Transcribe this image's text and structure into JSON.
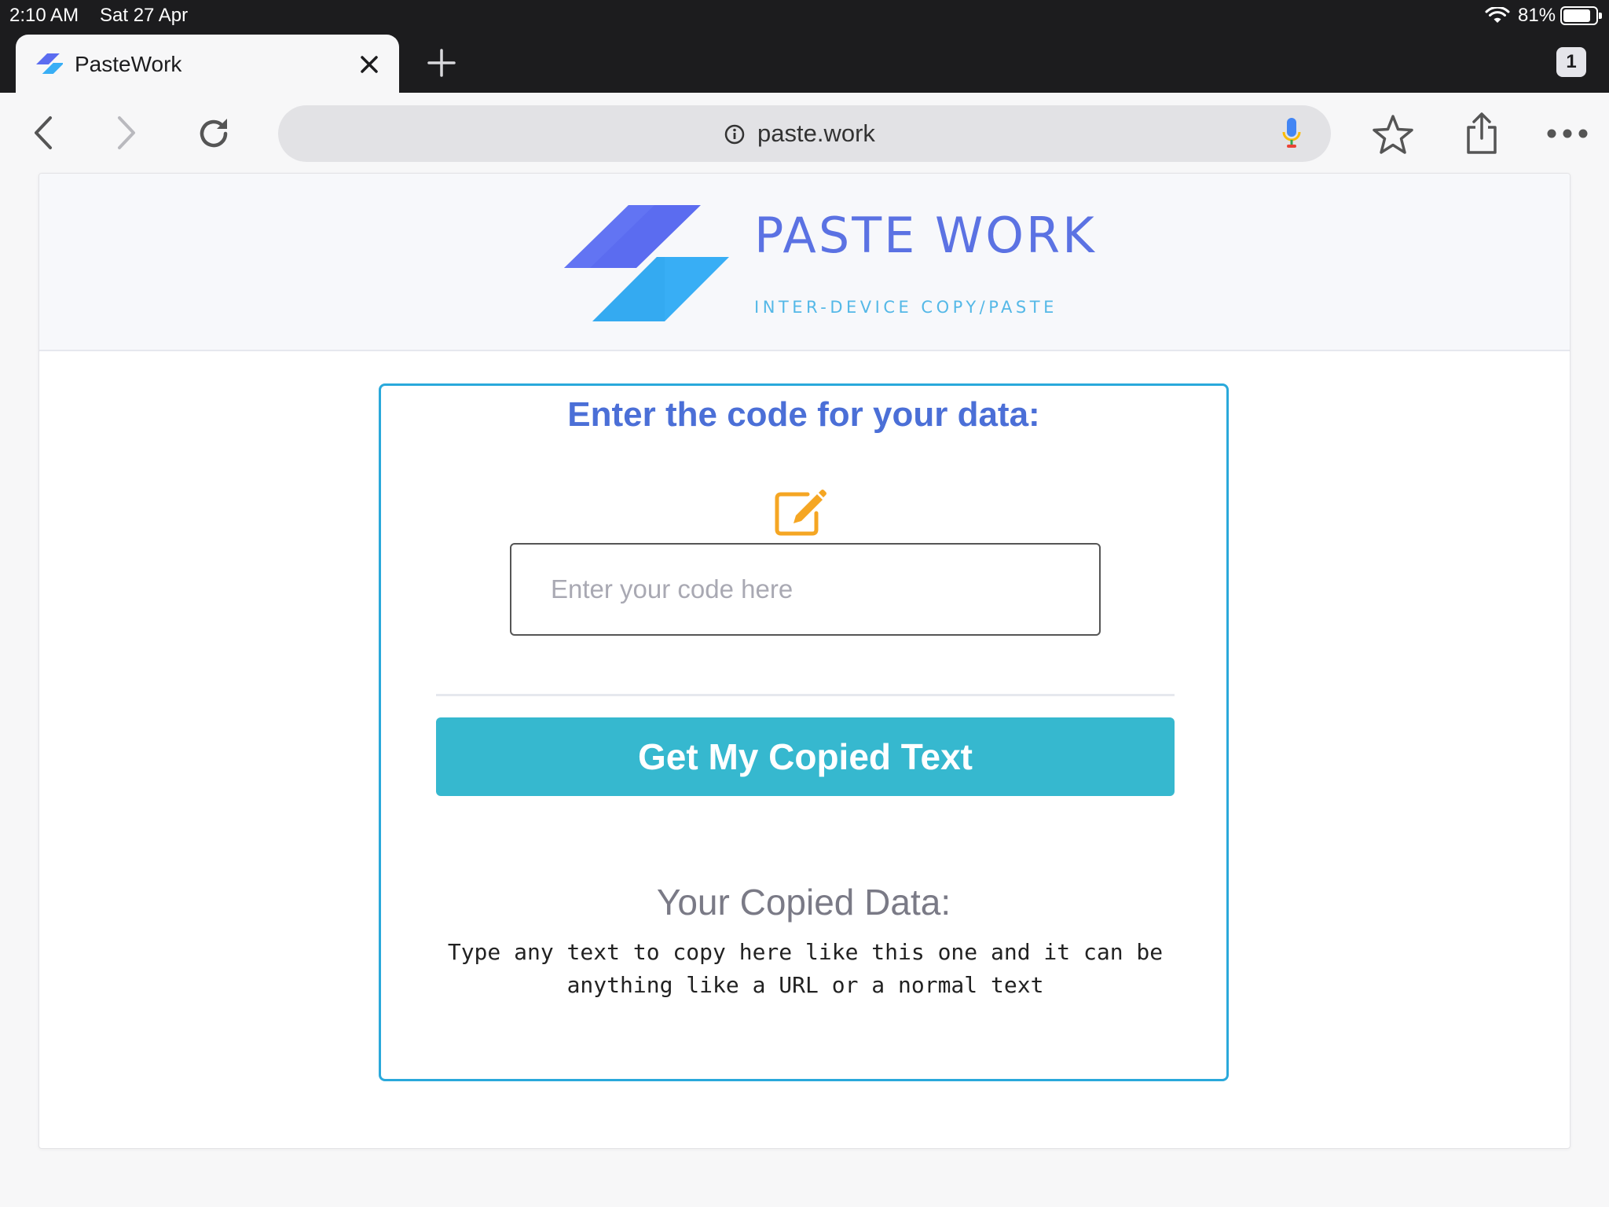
{
  "status_bar": {
    "time": "2:10 AM",
    "date": "Sat 27 Apr",
    "battery": "81%"
  },
  "tabs": [
    {
      "title": "PasteWork"
    }
  ],
  "tab_count": "1",
  "address_bar": {
    "url": "paste.work"
  },
  "site": {
    "brand": "PASTE WORK",
    "tagline": "INTER-DEVICE COPY/PASTE",
    "colors": {
      "brand_dark": "#5b72e3",
      "brand_light": "#38aef5",
      "accent": "#36b8cf",
      "border": "#2aa9db",
      "icon": "#f5a623"
    }
  },
  "form": {
    "prompt": "Enter the code for your data:",
    "code_input": {
      "placeholder": "Enter your code here",
      "value": ""
    },
    "submit_label": "Get My Copied Text"
  },
  "result": {
    "title": "Your Copied Data:",
    "text": "Type any text to copy here like this one and it can be anything like a URL or a normal text"
  }
}
